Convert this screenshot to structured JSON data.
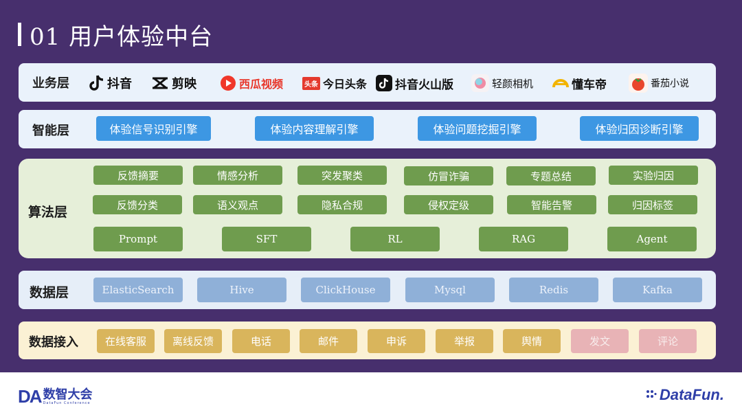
{
  "title": "01 用户体验中台",
  "layers": {
    "business": {
      "label": "业务层",
      "apps": [
        "抖音",
        "剪映",
        "西瓜视频",
        "今日头条",
        "抖音火山版",
        "轻颜相机",
        "懂车帝",
        "番茄小说"
      ],
      "toutiao_badge": "头条"
    },
    "intelligence": {
      "label": "智能层",
      "items": [
        "体验信号识别引擎",
        "体验内容理解引擎",
        "体验问题挖掘引擎",
        "体验归因诊断引擎"
      ]
    },
    "algorithm": {
      "label": "算法层",
      "row1": [
        "反馈摘要",
        "情感分析",
        "突发聚类",
        "仿冒诈骗",
        "专题总结",
        "实验归因"
      ],
      "row2": [
        "反馈分类",
        "语义观点",
        "隐私合规",
        "侵权定级",
        "智能告警",
        "归因标签"
      ],
      "row3": [
        "Prompt",
        "SFT",
        "RL",
        "RAG",
        "Agent"
      ]
    },
    "data": {
      "label": "数据层",
      "items": [
        "ElasticSearch",
        "Hive",
        "ClickHouse",
        "Mysql",
        "Redis",
        "Kafka"
      ]
    },
    "ingest": {
      "label": "数据接入",
      "items": [
        "在线客服",
        "离线反馈",
        "电话",
        "邮件",
        "申诉",
        "举报",
        "舆情",
        "发文",
        "评论"
      ]
    }
  },
  "footer": {
    "left_logo_mark": "DA",
    "left_logo_text": "数智大会",
    "left_logo_sub": "DataFun Conference",
    "right_logo": "DataFun."
  },
  "colors": {
    "background": "#472f6d",
    "business_panel": "#eaf2fb",
    "intelligence_panel": "#eaf2fb",
    "algorithm_panel": "#e6efd9",
    "data_panel": "#e6eef8",
    "ingest_panel": "#fbf1d4",
    "blue_chip": "#3d97e3",
    "green_chip": "#6f9c4e",
    "gray_chip": "#8fb0d8",
    "gold_chip": "#d9b55c",
    "pink_chip": "#e8b3b6"
  }
}
